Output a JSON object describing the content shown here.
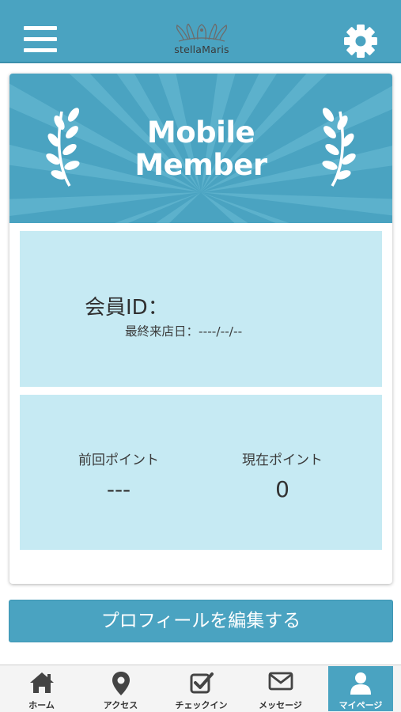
{
  "header": {
    "logo_text": "stellaMaris",
    "colors": {
      "accent": "#4aa3c1",
      "panel": "#c6eaf3"
    }
  },
  "card": {
    "banner_title_line1": "Mobile",
    "banner_title_line2": "Member",
    "member_id_label": "会員ID：",
    "last_visit_label": "最終来店日：",
    "last_visit_value": "----/--/--",
    "previous_points_label": "前回ポイント",
    "previous_points_value": "---",
    "current_points_label": "現在ポイント",
    "current_points_value": "0"
  },
  "edit_profile_label": "プロフィールを編集する",
  "tabbar": {
    "items": [
      {
        "label": "ホーム",
        "icon": "home-icon"
      },
      {
        "label": "アクセス",
        "icon": "map-pin-icon"
      },
      {
        "label": "チェックイン",
        "icon": "checkbox-icon"
      },
      {
        "label": "メッセージ",
        "icon": "envelope-icon"
      },
      {
        "label": "マイページ",
        "icon": "user-icon",
        "active": true
      }
    ]
  }
}
